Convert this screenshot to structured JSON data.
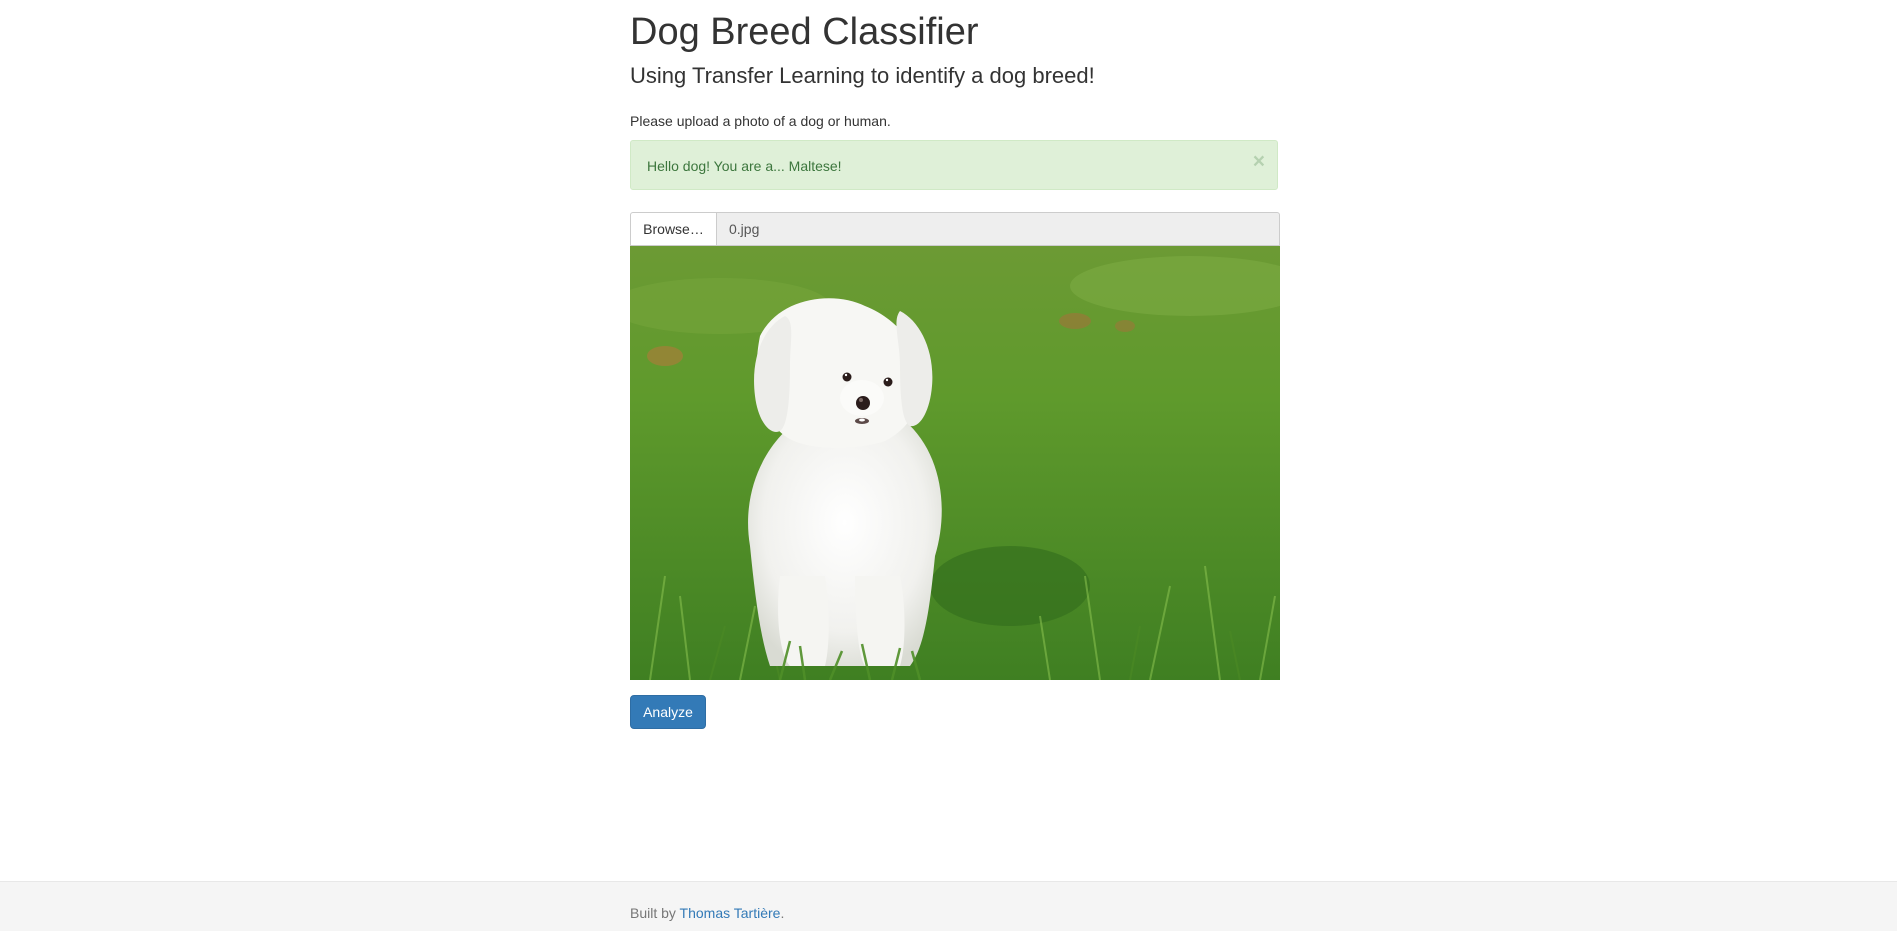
{
  "header": {
    "title": "Dog Breed Classifier",
    "subtitle": "Using Transfer Learning to identify a dog breed!"
  },
  "form": {
    "instructions": "Please upload a photo of a dog or human.",
    "alert": {
      "message": "Hello dog! You are a... Maltese!",
      "close_symbol": "×",
      "status_color": "#dff0d8"
    },
    "file_input": {
      "browse_label": "Browse…",
      "file_name": "0.jpg"
    },
    "analyze_label": "Analyze"
  },
  "footer": {
    "prefix": "Built by ",
    "author": "Thomas Tartière",
    "suffix": "."
  },
  "colors": {
    "primary": "#337ab7",
    "success_text": "#3c763d"
  }
}
